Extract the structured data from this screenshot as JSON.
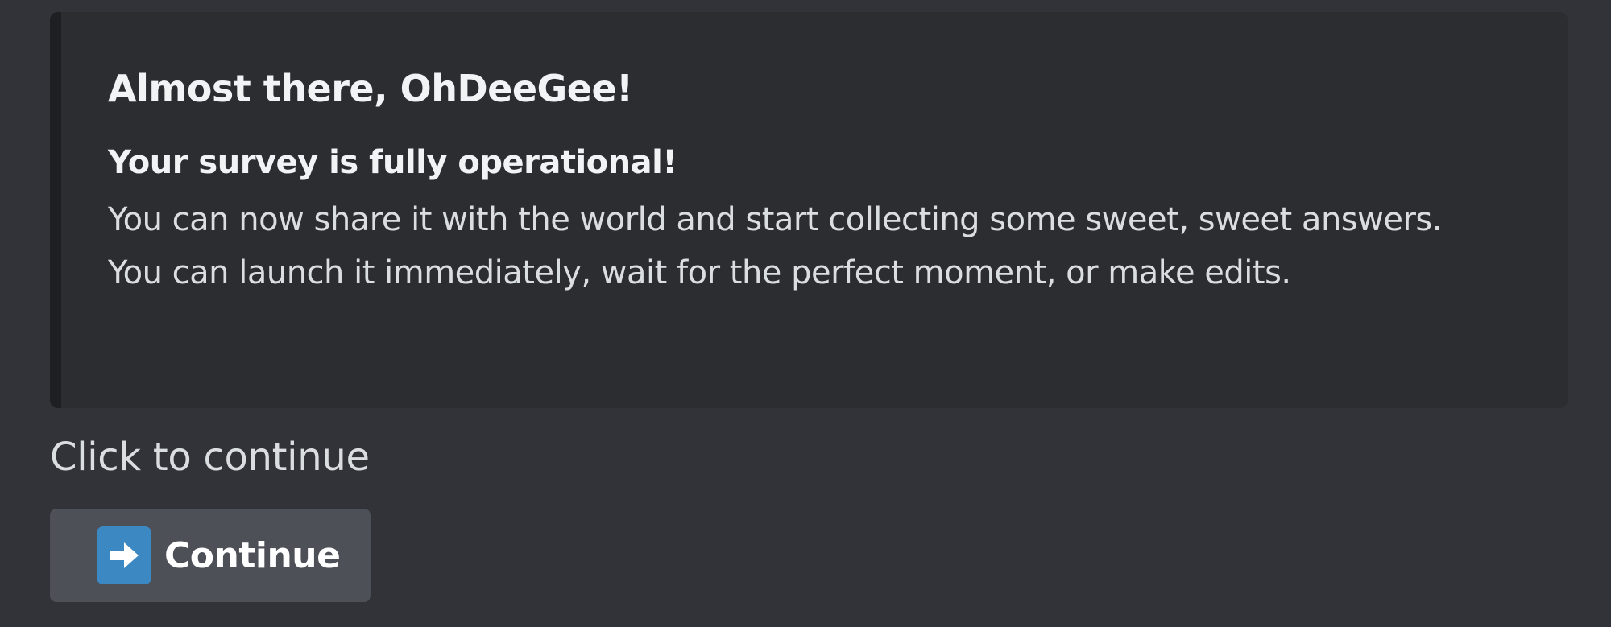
{
  "embed": {
    "title": "Almost there, OhDeeGee!",
    "subtitle": "Your survey is fully operational!",
    "body_lines": [
      "You can now share it with the world and start collecting some sweet, sweet answers.",
      "You can launch it immediately, wait for the perfect moment, or make edits."
    ]
  },
  "prompt": {
    "text": "Click to continue"
  },
  "continue_button": {
    "label": "Continue",
    "icon": "right-arrow-icon"
  },
  "colors": {
    "background": "#313338",
    "embed_background": "#2b2d31",
    "button_background": "#4e5058",
    "icon_background": "#3b88c3"
  }
}
